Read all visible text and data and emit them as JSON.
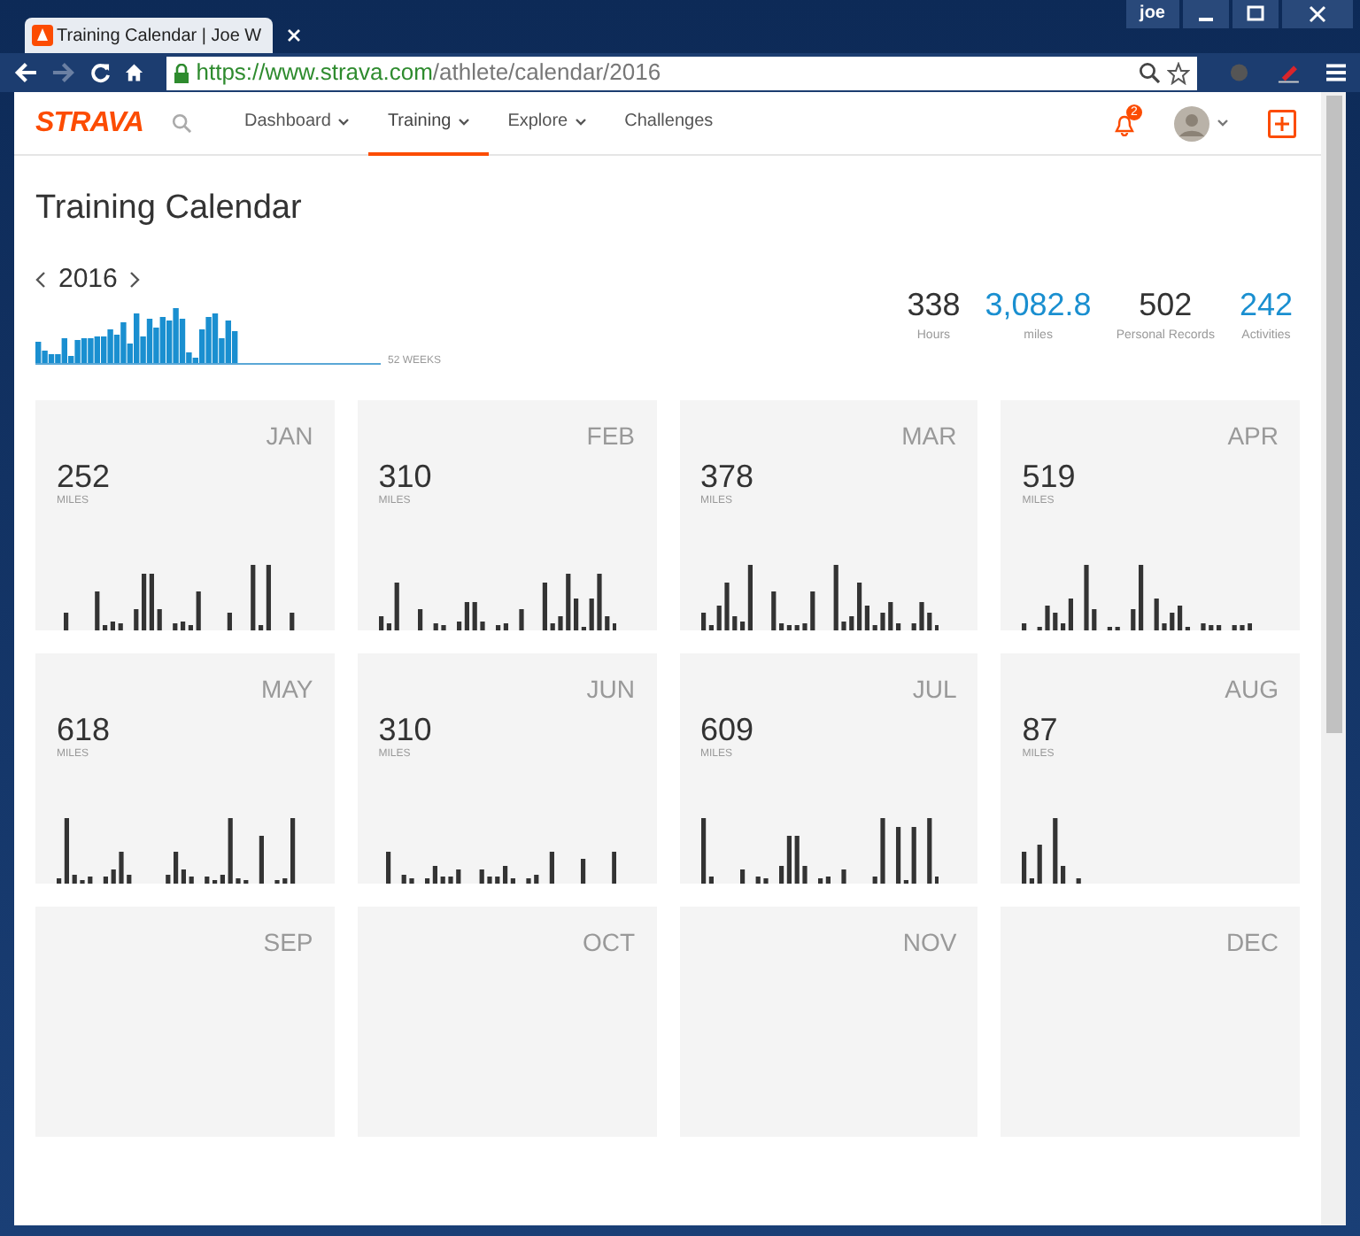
{
  "browser": {
    "tab_title": "Training Calendar | Joe W",
    "user": "joe",
    "url_host": "https://www.strava.com",
    "url_path": "/athlete/calendar/2016"
  },
  "nav": {
    "logo": "STRAVA",
    "notification_count": "2",
    "items": [
      {
        "label": "Dashboard",
        "dropdown": true,
        "selected": false
      },
      {
        "label": "Training",
        "dropdown": true,
        "selected": true
      },
      {
        "label": "Explore",
        "dropdown": true,
        "selected": false
      },
      {
        "label": "Challenges",
        "dropdown": false,
        "selected": false
      }
    ]
  },
  "page": {
    "title": "Training Calendar",
    "year": "2016",
    "weeks_label": "52 WEEKS"
  },
  "stats": [
    {
      "value": "338",
      "label": "Hours",
      "highlight": false
    },
    {
      "value": "3,082.8",
      "label": "miles",
      "highlight": true
    },
    {
      "value": "502",
      "label": "Personal Records",
      "highlight": false
    },
    {
      "value": "242",
      "label": "Activities",
      "highlight": true
    }
  ],
  "months": [
    {
      "name": "JAN",
      "miles": "252",
      "unit": "MILES"
    },
    {
      "name": "FEB",
      "miles": "310",
      "unit": "MILES"
    },
    {
      "name": "MAR",
      "miles": "378",
      "unit": "MILES"
    },
    {
      "name": "APR",
      "miles": "519",
      "unit": "MILES"
    },
    {
      "name": "MAY",
      "miles": "618",
      "unit": "MILES"
    },
    {
      "name": "JUN",
      "miles": "310",
      "unit": "MILES"
    },
    {
      "name": "JUL",
      "miles": "609",
      "unit": "MILES"
    },
    {
      "name": "AUG",
      "miles": "87",
      "unit": "MILES"
    },
    {
      "name": "SEP"
    },
    {
      "name": "OCT"
    },
    {
      "name": "NOV"
    },
    {
      "name": "DEC"
    }
  ]
}
